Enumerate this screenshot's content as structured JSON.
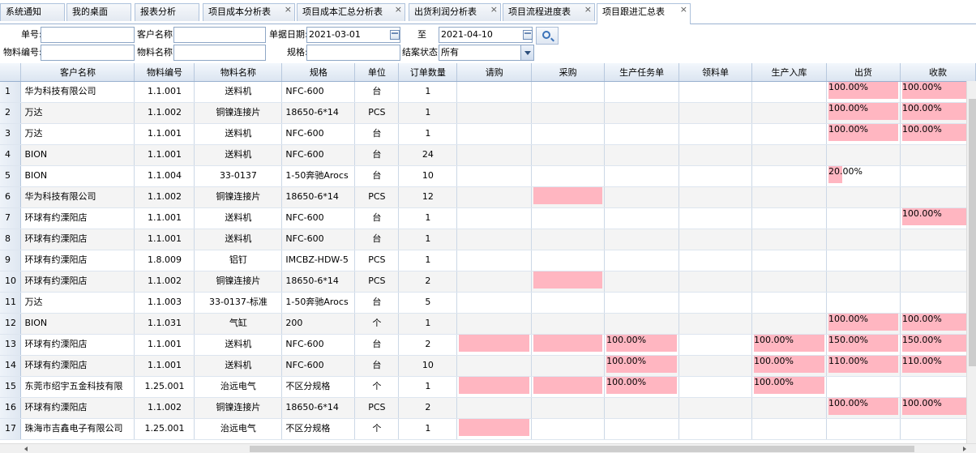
{
  "tabs": [
    {
      "label": "系统通知",
      "closable": false
    },
    {
      "label": "我的桌面",
      "closable": false
    },
    {
      "label": "报表分析",
      "closable": false
    },
    {
      "label": "项目成本分析表",
      "closable": true
    },
    {
      "label": "项目成本汇总分析表",
      "closable": true
    },
    {
      "label": "出货利润分析表",
      "closable": true
    },
    {
      "label": "项目流程进度表",
      "closable": true
    },
    {
      "label": "项目跟进汇总表",
      "closable": true,
      "active": true
    }
  ],
  "close_glyph": "×",
  "filters": {
    "order_no_label": "单号:",
    "order_no_value": "",
    "customer_label": "客户名称:",
    "customer_value": "",
    "date_label": "单据日期:",
    "date_from": "2021-03-01",
    "date_to_label": "至",
    "date_to": "2021-04-10",
    "material_no_label": "物料编号:",
    "material_no_value": "",
    "material_name_label": "物料名称:",
    "material_name_value": "",
    "spec_label": "规格:",
    "spec_value": "",
    "status_label": "结案状态:",
    "status_value": "所有"
  },
  "columns": [
    "客户名称",
    "物料编号",
    "物料名称",
    "规格",
    "单位",
    "订单数量",
    "请购",
    "采购",
    "生产任务单",
    "领料单",
    "生产入库",
    "出货",
    "收款"
  ],
  "colors": {
    "progress": "#ffb6c1",
    "header": "#dbe5f1",
    "alt_row": "#f4f4f4"
  },
  "rows": [
    {
      "n": "1",
      "customer": "华为科技有限公司",
      "mat_no": "1.1.001",
      "mat_name": "送料机",
      "spec": "NFC-600",
      "unit": "台",
      "qty": "1",
      "req": null,
      "pur": null,
      "task": null,
      "pick": null,
      "stock": null,
      "ship": "100.00%",
      "pay": "100.00%"
    },
    {
      "n": "2",
      "customer": "万达",
      "mat_no": "1.1.002",
      "mat_name": "铜镍连接片",
      "spec": "18650-6*14",
      "unit": "PCS",
      "qty": "1",
      "req": null,
      "pur": null,
      "task": null,
      "pick": null,
      "stock": null,
      "ship": "100.00%",
      "pay": "100.00%"
    },
    {
      "n": "3",
      "customer": "万达",
      "mat_no": "1.1.001",
      "mat_name": "送料机",
      "spec": "NFC-600",
      "unit": "台",
      "qty": "1",
      "req": null,
      "pur": null,
      "task": null,
      "pick": null,
      "stock": null,
      "ship": "100.00%",
      "pay": "100.00%"
    },
    {
      "n": "4",
      "customer": "BION",
      "mat_no": "1.1.001",
      "mat_name": "送料机",
      "spec": "NFC-600",
      "unit": "台",
      "qty": "24",
      "req": null,
      "pur": null,
      "task": null,
      "pick": null,
      "stock": null,
      "ship": null,
      "pay": null
    },
    {
      "n": "5",
      "customer": "BION",
      "mat_no": "1.1.004",
      "mat_name": "33-0137",
      "spec": "1-50奔驰Arocs",
      "unit": "台",
      "qty": "10",
      "req": null,
      "pur": null,
      "task": null,
      "pick": null,
      "stock": null,
      "ship": "20.00%",
      "pay": null
    },
    {
      "n": "6",
      "customer": "华为科技有限公司",
      "mat_no": "1.1.002",
      "mat_name": "铜镍连接片",
      "spec": "18650-6*14",
      "unit": "PCS",
      "qty": "12",
      "req": null,
      "pur": "",
      "task": null,
      "pick": null,
      "stock": null,
      "ship": null,
      "pay": null
    },
    {
      "n": "7",
      "customer": "环球有约溧阳店",
      "mat_no": "1.1.001",
      "mat_name": "送料机",
      "spec": "NFC-600",
      "unit": "台",
      "qty": "1",
      "req": null,
      "pur": null,
      "task": null,
      "pick": null,
      "stock": null,
      "ship": null,
      "pay": "100.00%"
    },
    {
      "n": "8",
      "customer": "环球有约溧阳店",
      "mat_no": "1.1.001",
      "mat_name": "送料机",
      "spec": "NFC-600",
      "unit": "台",
      "qty": "1",
      "req": null,
      "pur": null,
      "task": null,
      "pick": null,
      "stock": null,
      "ship": null,
      "pay": null
    },
    {
      "n": "9",
      "customer": "环球有约溧阳店",
      "mat_no": "1.8.009",
      "mat_name": "铝钉",
      "spec": "IMCBZ-HDW-5",
      "unit": "PCS",
      "qty": "1",
      "req": null,
      "pur": null,
      "task": null,
      "pick": null,
      "stock": null,
      "ship": null,
      "pay": null
    },
    {
      "n": "10",
      "customer": "环球有约溧阳店",
      "mat_no": "1.1.002",
      "mat_name": "铜镍连接片",
      "spec": "18650-6*14",
      "unit": "PCS",
      "qty": "2",
      "req": null,
      "pur": "",
      "task": null,
      "pick": null,
      "stock": null,
      "ship": null,
      "pay": null
    },
    {
      "n": "11",
      "customer": "万达",
      "mat_no": "1.1.003",
      "mat_name": "33-0137-标准",
      "spec": "1-50奔驰Arocs",
      "unit": "台",
      "qty": "5",
      "req": null,
      "pur": null,
      "task": null,
      "pick": null,
      "stock": null,
      "ship": null,
      "pay": null
    },
    {
      "n": "12",
      "customer": "BION",
      "mat_no": "1.1.031",
      "mat_name": "气缸",
      "spec": "200",
      "unit": "个",
      "qty": "1",
      "req": null,
      "pur": null,
      "task": null,
      "pick": null,
      "stock": null,
      "ship": "100.00%",
      "pay": "100.00%"
    },
    {
      "n": "13",
      "customer": "环球有约溧阳店",
      "mat_no": "1.1.001",
      "mat_name": "送料机",
      "spec": "NFC-600",
      "unit": "台",
      "qty": "2",
      "req": "",
      "pur": "",
      "task": "100.00%",
      "pick": null,
      "stock": "100.00%",
      "ship": "150.00%",
      "pay": "150.00%"
    },
    {
      "n": "14",
      "customer": "环球有约溧阳店",
      "mat_no": "1.1.001",
      "mat_name": "送料机",
      "spec": "NFC-600",
      "unit": "台",
      "qty": "10",
      "req": null,
      "pur": null,
      "task": "100.00%",
      "pick": null,
      "stock": "100.00%",
      "ship": "110.00%",
      "pay": "110.00%"
    },
    {
      "n": "15",
      "customer": "东莞市绍宇五金科技有限",
      "mat_no": "1.25.001",
      "mat_name": "治远电气",
      "spec": "不区分规格",
      "unit": "个",
      "qty": "1",
      "req": "",
      "pur": "",
      "task": "100.00%",
      "pick": null,
      "stock": "100.00%",
      "ship": null,
      "pay": null
    },
    {
      "n": "16",
      "customer": "环球有约溧阳店",
      "mat_no": "1.1.002",
      "mat_name": "铜镍连接片",
      "spec": "18650-6*14",
      "unit": "PCS",
      "qty": "2",
      "req": null,
      "pur": null,
      "task": null,
      "pick": null,
      "stock": null,
      "ship": "100.00%",
      "pay": "100.00%"
    },
    {
      "n": "17",
      "customer": "珠海市吉鑫电子有限公司",
      "mat_no": "1.25.001",
      "mat_name": "治远电气",
      "spec": "不区分规格",
      "unit": "个",
      "qty": "1",
      "req": "",
      "pur": null,
      "task": null,
      "pick": null,
      "stock": null,
      "ship": null,
      "pay": null
    }
  ]
}
